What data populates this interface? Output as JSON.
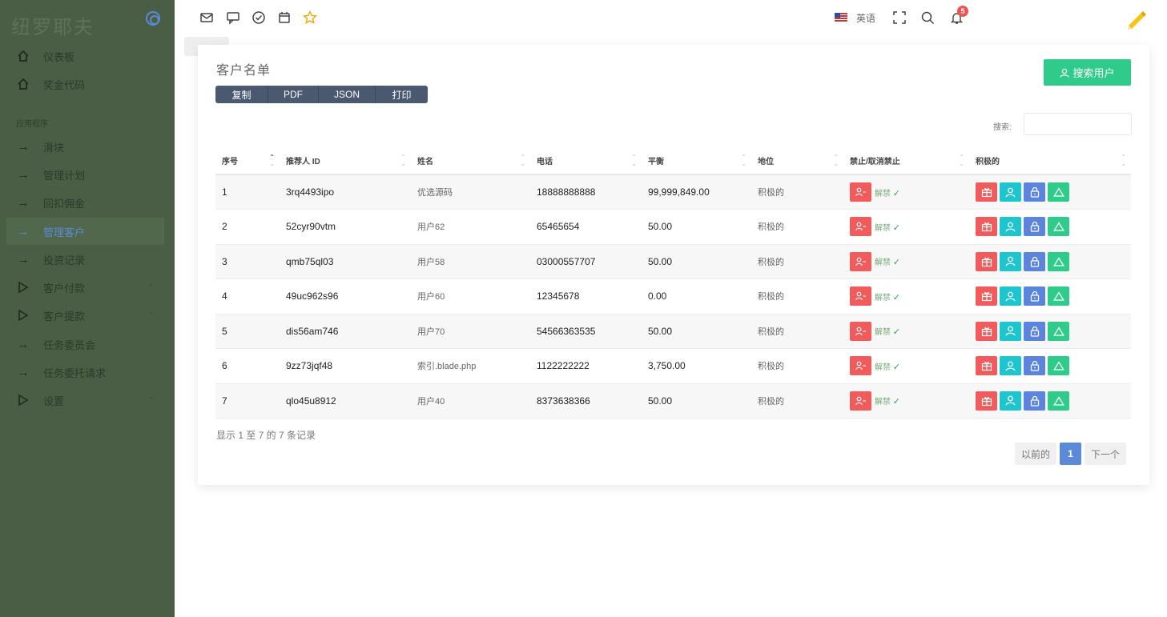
{
  "sidebar": {
    "brand": "纽罗耶夫",
    "section_label": "应用程序",
    "items": [
      {
        "label": "仪表板",
        "icon": "home-icon"
      },
      {
        "label": "奖金代码",
        "icon": "home-icon"
      },
      {
        "label": "滑块",
        "icon": "arrow-right-icon"
      },
      {
        "label": "管理计划",
        "icon": "arrow-right-icon"
      },
      {
        "label": "回扣佣金",
        "icon": "arrow-right-icon"
      },
      {
        "label": "管理客户",
        "icon": "arrow-right-icon",
        "active": true
      },
      {
        "label": "投资记录",
        "icon": "arrow-right-icon"
      },
      {
        "label": "客户付款",
        "icon": "play-icon",
        "expandable": true
      },
      {
        "label": "客户提款",
        "icon": "play-icon",
        "expandable": true
      },
      {
        "label": "任务委员会",
        "icon": "arrow-right-icon"
      },
      {
        "label": "任务委托请求",
        "icon": "arrow-right-icon"
      },
      {
        "label": "设置",
        "icon": "play-icon",
        "expandable": true
      }
    ]
  },
  "topbar": {
    "icons": [
      "mail-icon",
      "chat-icon",
      "check-circle-icon",
      "calendar-icon",
      "star-icon"
    ],
    "language": "英语",
    "notification_count": "5"
  },
  "card": {
    "title": "客户名单",
    "export_buttons": [
      "复制",
      "PDF",
      "JSON",
      "打印"
    ],
    "search_user_button": "搜索用户",
    "search_label": "搜索:",
    "search_value": "",
    "columns": [
      "序号",
      "推荐人 ID",
      "姓名",
      "电话",
      "平衡",
      "地位",
      "禁止/取消禁止",
      "积极的"
    ],
    "rows": [
      {
        "no": "1",
        "ref_id": "3rq4493ipo",
        "name": "优选源码",
        "phone": "18888888888",
        "balance": "99,999,849.00",
        "status": "积极的",
        "unban": "解禁"
      },
      {
        "no": "2",
        "ref_id": "52cyr90vtm",
        "name": "用户62",
        "phone": "65465654",
        "balance": "50.00",
        "status": "积极的",
        "unban": "解禁"
      },
      {
        "no": "3",
        "ref_id": "qmb75ql03",
        "name": "用户58",
        "phone": "03000557707",
        "balance": "50.00",
        "status": "积极的",
        "unban": "解禁"
      },
      {
        "no": "4",
        "ref_id": "49uc962s96",
        "name": "用户60",
        "phone": "12345678",
        "balance": "0.00",
        "status": "积极的",
        "unban": "解禁"
      },
      {
        "no": "5",
        "ref_id": "dis56am746",
        "name": "用户70",
        "phone": "54566363535",
        "balance": "50.00",
        "status": "积极的",
        "unban": "解禁"
      },
      {
        "no": "6",
        "ref_id": "9zz73jqf48",
        "name": "索引.blade.php",
        "phone": "1122222222",
        "balance": "3,750.00",
        "status": "积极的",
        "unban": "解禁"
      },
      {
        "no": "7",
        "ref_id": "qlo45u8912",
        "name": "用户40",
        "phone": "8373638366",
        "balance": "50.00",
        "status": "积极的",
        "unban": "解禁"
      }
    ],
    "info": "显示 1 至 7 的 7 条记录",
    "pagination": {
      "prev": "以前的",
      "current": "1",
      "next": "下一个"
    }
  },
  "colors": {
    "sidebar_bg": "#4a5e45",
    "accent_blue": "#5b8ad8",
    "green": "#2ecb8a",
    "red": "#f25b5b",
    "cyan": "#1dc6cf"
  }
}
